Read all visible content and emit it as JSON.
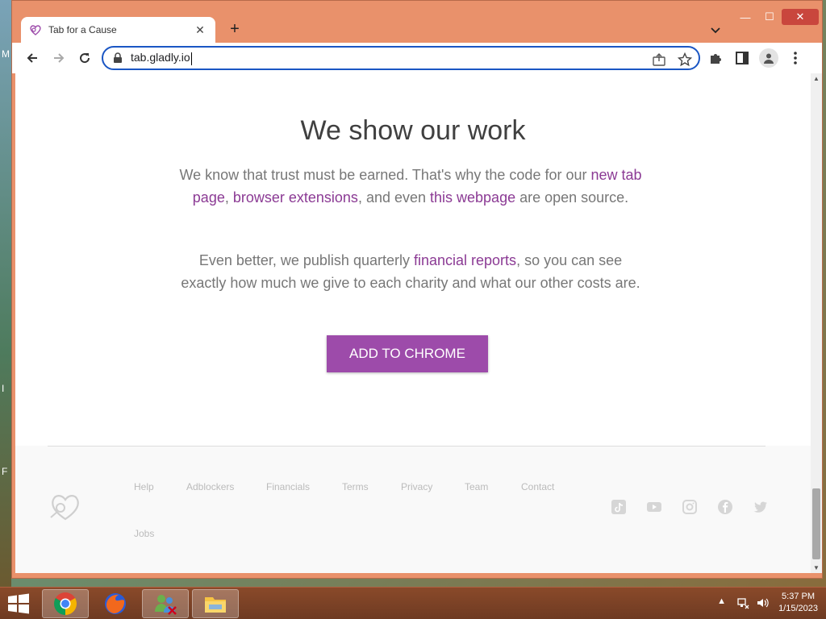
{
  "desktop": {
    "edge_letters": [
      "M",
      "I",
      "F"
    ]
  },
  "browser": {
    "tab": {
      "title": "Tab for a Cause",
      "favicon": "heart-logo-icon",
      "close": "✕"
    },
    "newtab_label": "+",
    "window_controls": {
      "minimize": "—",
      "maximize": "☐",
      "close": "✕"
    },
    "url": "tab.gladly.io"
  },
  "page": {
    "heading": "We show our work",
    "p1": {
      "text1": "We know that trust must be earned. That's why the code for our ",
      "link1": "new tab page",
      "sep1": ", ",
      "link2": "browser extensions",
      "text2": ", and even ",
      "link3": "this webpage",
      "text3": " are open source."
    },
    "p2": {
      "text1": "Even better, we publish quarterly ",
      "link1": "financial reports",
      "text2": ", so you can see exactly how much we give to each charity and what our other costs are."
    },
    "cta_label": "ADD TO CHROME",
    "footer": {
      "links": [
        "Help",
        "Adblockers",
        "Financials",
        "Terms",
        "Privacy",
        "Team",
        "Contact",
        "Jobs"
      ],
      "social": [
        "tiktok-icon",
        "youtube-icon",
        "instagram-icon",
        "facebook-icon",
        "twitter-icon"
      ]
    }
  },
  "taskbar": {
    "apps": [
      "chrome-icon",
      "firefox-icon",
      "network-users-icon",
      "file-explorer-icon"
    ],
    "time": "5:37 PM",
    "date": "1/15/2023"
  },
  "colors": {
    "accent": "#9d4baa",
    "link": "#8b3a94",
    "window_frame": "#e9916b",
    "omnibox_focus": "#1a56c4"
  }
}
